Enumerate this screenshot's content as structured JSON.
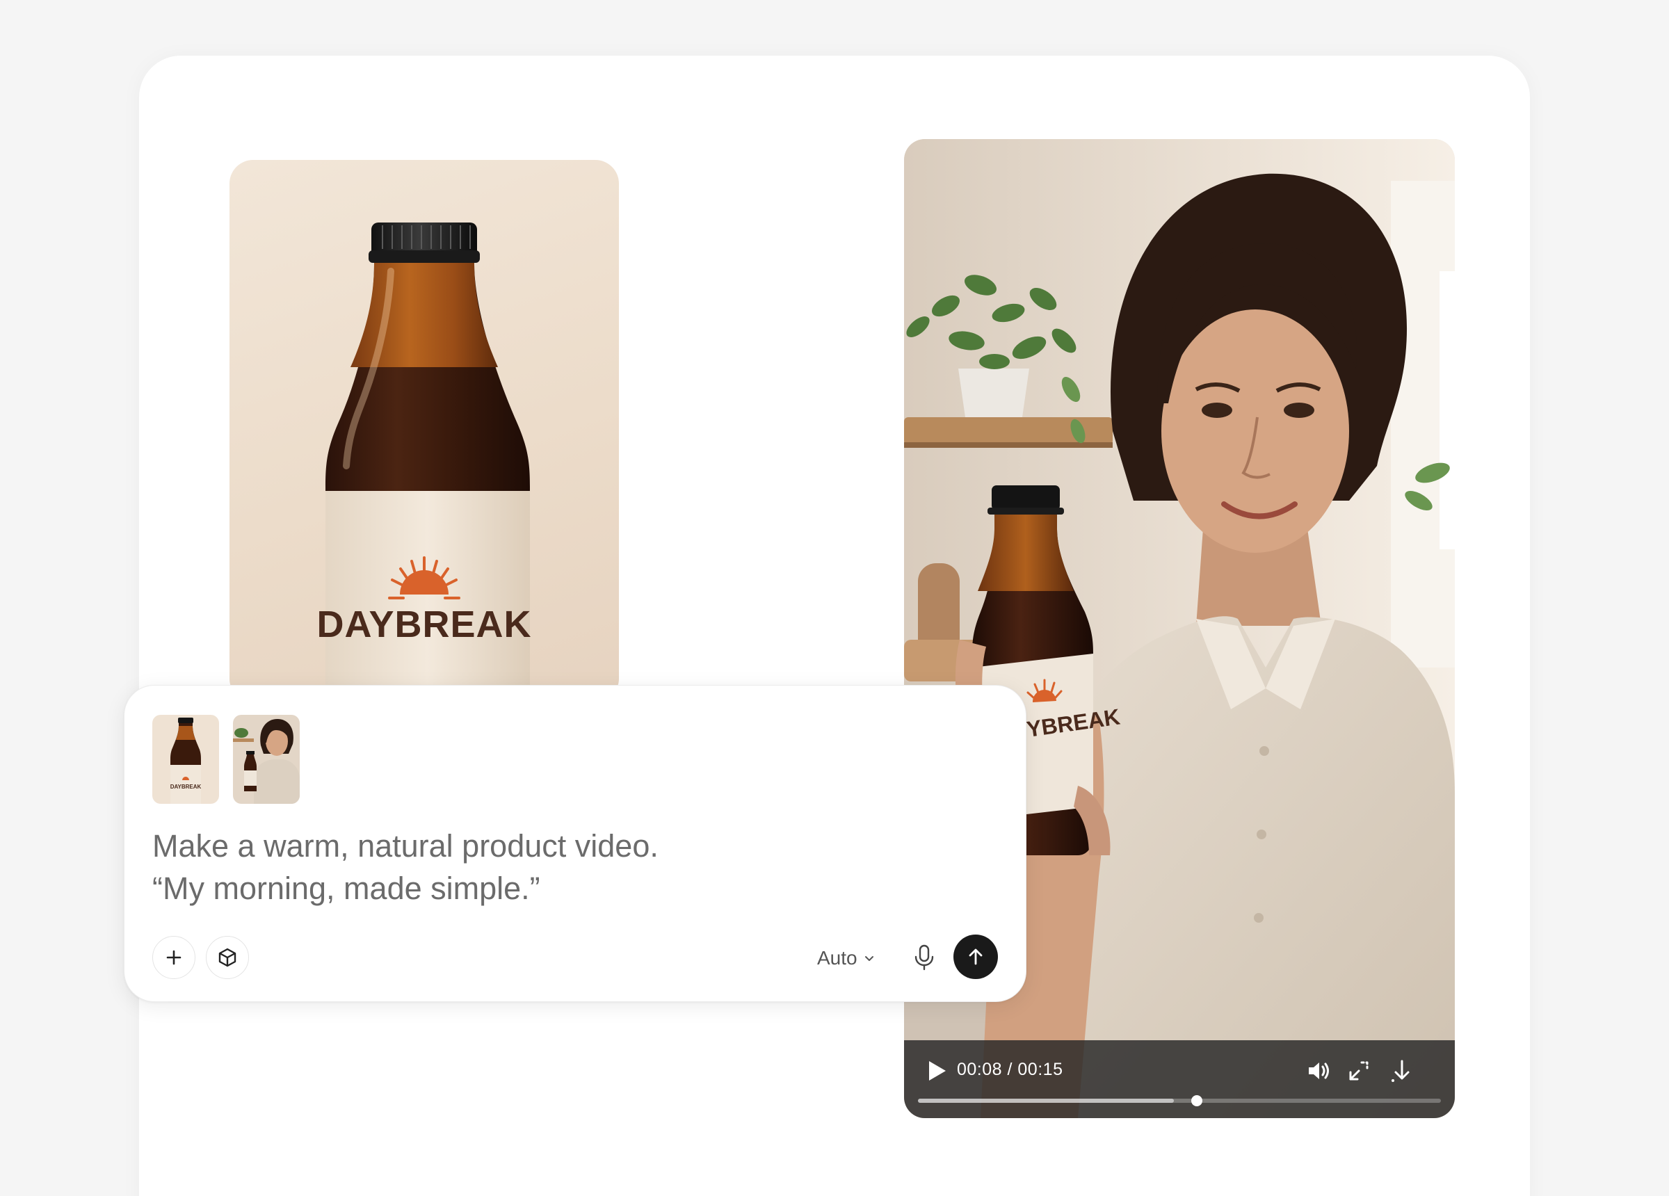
{
  "product_image": {
    "brand_label": "DAYBREAK"
  },
  "video": {
    "current_time": "00:08",
    "duration": "00:15",
    "time_separator": " / ",
    "progress_fraction": 0.533,
    "buffered_fraction": 0.49,
    "bottle_label_visible": "YBREAK"
  },
  "composer": {
    "attachments": [
      {
        "name": "product-bottle-thumbnail",
        "label": "DAYBREAK"
      },
      {
        "name": "woman-holding-bottle-thumbnail",
        "label": ""
      }
    ],
    "prompt_lines": [
      "Make a warm, natural product video.",
      "“My morning, made simple.”"
    ],
    "mode_label": "Auto"
  },
  "colors": {
    "send_button": "#1a1a1a",
    "label_brown": "#4a2a1c",
    "sun_orange": "#d9622b",
    "prompt_text": "#6b6b6b"
  },
  "icons": {
    "add": "plus-icon",
    "model": "cube-icon",
    "mode_chevron": "chevron-down-icon",
    "mic": "microphone-icon",
    "send": "arrow-up-icon",
    "play": "play-icon",
    "volume": "volume-icon",
    "fullscreen": "fullscreen-icon",
    "download": "download-icon"
  }
}
